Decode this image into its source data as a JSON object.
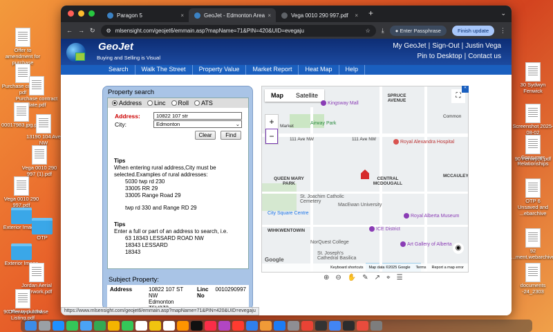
{
  "desktop": {
    "left_icons": [
      {
        "label": "Offer to amendment for purchase"
      },
      {
        "label": "Purchase contract pdf"
      },
      {
        "label": "Purchase contract date.pdf"
      },
      {
        "label": "00017983.jpg.pdf"
      },
      {
        "label": "13190 104 Ave NW"
      },
      {
        "label": "Vega 0010 290 997 (1).pdf"
      },
      {
        "label": "Vega 0010 290 997.pdf"
      },
      {
        "label": "Exterior Images"
      },
      {
        "label": "OTP"
      },
      {
        "label": "Exterior Image"
      },
      {
        "label": "Jordan Aerial Overwork.pdf"
      },
      {
        "label": "90 Fenwyck blvd Listing.pdf"
      },
      {
        "label": "Offer to purchase"
      }
    ],
    "right_icons": [
      {
        "label": "30 Sydwyn Fenwick"
      },
      {
        "label": "Screenshot 2025-08-02"
      },
      {
        "label": "Consumer Relationships"
      },
      {
        "label": "90 Fenwyck.pdf"
      },
      {
        "label": "OTP 6"
      },
      {
        "label": "Unsaved and ...ebarchive"
      },
      {
        "label": "92 ...ment.webarchive"
      },
      {
        "label": "documents -24_2303"
      }
    ]
  },
  "browser": {
    "tabs": [
      {
        "label": "Paragon 5"
      },
      {
        "label": "GeoJet - Edmonton Area"
      },
      {
        "label": "Vega 0010 290 997.pdf"
      }
    ],
    "url": "mlsensight.com/geojet6/emmain.asp?mapName=71&PIN=420&UID=evegaju",
    "passphrase_label": "Enter Passphrase",
    "finish_update_label": "Finish update",
    "status_url": "https://www.mlsensight.com/geojet6/emmain.asp?mapName=71&PIN=420&UID=evegaju"
  },
  "geojet": {
    "logo_title": "GeoJet",
    "logo_subtitle": "Buying and Selling is Visual",
    "top_links": {
      "my_geojet": "My GeoJet",
      "sign_out": "Sign-Out",
      "user": "Justin Vega",
      "pin_desktop": "Pin to Desktop",
      "contact": "Contact us"
    },
    "nav": [
      "Search",
      "Walk The Street",
      "Property Value",
      "Market Report",
      "Heat Map",
      "Help"
    ],
    "search_panel": {
      "title": "Property search",
      "radios": [
        "Address",
        "Linc",
        "Roll",
        "ATS"
      ],
      "address_label": "Address:",
      "address_value": "10822 107 str",
      "city_label": "City:",
      "city_value": "Edmonton",
      "clear_label": "Clear",
      "find_label": "Find",
      "tips1_title": "Tips",
      "tips1_text": "When entering rural address,City must be selected.Examples of rural addresses:",
      "tips1_examples": [
        "5030 twp rd 230",
        "33005 RR 29",
        "33005 Range Road 29",
        "twp rd 330 and Range RD 29"
      ],
      "tips2_title": "Tips",
      "tips2_text": "Enter a full or part of an address to search, i.e.",
      "tips2_examples": [
        "63 18343 LESSARD ROAD NW",
        "18343 LESSARD",
        "18343"
      ]
    },
    "subject": {
      "title": "Subject Property:",
      "label": "Address",
      "address_line1": "10822 107 ST NW",
      "address_line2": "Edmonton T5H2Z3",
      "linc_label": "Linc",
      "linc_value": "0010290997",
      "no_label": "No"
    },
    "map": {
      "tab_map": "Map",
      "tab_satellite": "Satellite",
      "labels": [
        "SPRUCE AVENUE",
        "Kingsway Mall",
        "Airway Park",
        "Market",
        "111 Ave NW",
        "111 Ave NW",
        "Royal Alexandra Hospital",
        "Common",
        "QUEEN MARY PARK",
        "CENTRAL MCDOUGALL",
        "MCCAULEY",
        "St. Joachim Catholic Cemetery",
        "MacEwan University",
        "Royal Alberta Museum",
        "City Square Centre",
        "WIHKWENTOWIN",
        "ICE District",
        "NorQuest College",
        "Art Gallery of Alberta",
        "St. Joseph's Cathedral Basilica",
        "Google"
      ],
      "attribution": [
        "Keyboard shortcuts",
        "Map data ©2025 Google",
        "Terms",
        "Report a map error"
      ]
    }
  }
}
